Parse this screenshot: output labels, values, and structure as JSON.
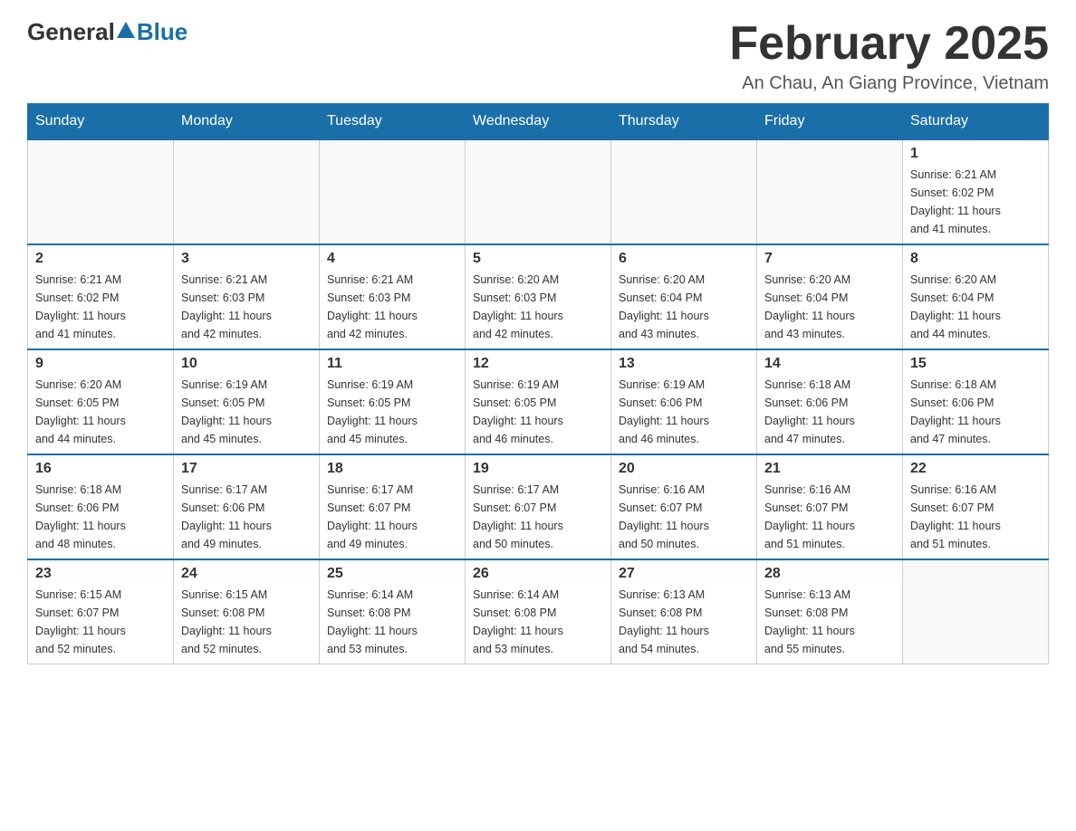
{
  "header": {
    "logo": {
      "general": "General",
      "blue": "Blue"
    },
    "title": "February 2025",
    "location": "An Chau, An Giang Province, Vietnam"
  },
  "days_of_week": [
    "Sunday",
    "Monday",
    "Tuesday",
    "Wednesday",
    "Thursday",
    "Friday",
    "Saturday"
  ],
  "weeks": [
    [
      {
        "day": "",
        "info": ""
      },
      {
        "day": "",
        "info": ""
      },
      {
        "day": "",
        "info": ""
      },
      {
        "day": "",
        "info": ""
      },
      {
        "day": "",
        "info": ""
      },
      {
        "day": "",
        "info": ""
      },
      {
        "day": "1",
        "info": "Sunrise: 6:21 AM\nSunset: 6:02 PM\nDaylight: 11 hours\nand 41 minutes."
      }
    ],
    [
      {
        "day": "2",
        "info": "Sunrise: 6:21 AM\nSunset: 6:02 PM\nDaylight: 11 hours\nand 41 minutes."
      },
      {
        "day": "3",
        "info": "Sunrise: 6:21 AM\nSunset: 6:03 PM\nDaylight: 11 hours\nand 42 minutes."
      },
      {
        "day": "4",
        "info": "Sunrise: 6:21 AM\nSunset: 6:03 PM\nDaylight: 11 hours\nand 42 minutes."
      },
      {
        "day": "5",
        "info": "Sunrise: 6:20 AM\nSunset: 6:03 PM\nDaylight: 11 hours\nand 42 minutes."
      },
      {
        "day": "6",
        "info": "Sunrise: 6:20 AM\nSunset: 6:04 PM\nDaylight: 11 hours\nand 43 minutes."
      },
      {
        "day": "7",
        "info": "Sunrise: 6:20 AM\nSunset: 6:04 PM\nDaylight: 11 hours\nand 43 minutes."
      },
      {
        "day": "8",
        "info": "Sunrise: 6:20 AM\nSunset: 6:04 PM\nDaylight: 11 hours\nand 44 minutes."
      }
    ],
    [
      {
        "day": "9",
        "info": "Sunrise: 6:20 AM\nSunset: 6:05 PM\nDaylight: 11 hours\nand 44 minutes."
      },
      {
        "day": "10",
        "info": "Sunrise: 6:19 AM\nSunset: 6:05 PM\nDaylight: 11 hours\nand 45 minutes."
      },
      {
        "day": "11",
        "info": "Sunrise: 6:19 AM\nSunset: 6:05 PM\nDaylight: 11 hours\nand 45 minutes."
      },
      {
        "day": "12",
        "info": "Sunrise: 6:19 AM\nSunset: 6:05 PM\nDaylight: 11 hours\nand 46 minutes."
      },
      {
        "day": "13",
        "info": "Sunrise: 6:19 AM\nSunset: 6:06 PM\nDaylight: 11 hours\nand 46 minutes."
      },
      {
        "day": "14",
        "info": "Sunrise: 6:18 AM\nSunset: 6:06 PM\nDaylight: 11 hours\nand 47 minutes."
      },
      {
        "day": "15",
        "info": "Sunrise: 6:18 AM\nSunset: 6:06 PM\nDaylight: 11 hours\nand 47 minutes."
      }
    ],
    [
      {
        "day": "16",
        "info": "Sunrise: 6:18 AM\nSunset: 6:06 PM\nDaylight: 11 hours\nand 48 minutes."
      },
      {
        "day": "17",
        "info": "Sunrise: 6:17 AM\nSunset: 6:06 PM\nDaylight: 11 hours\nand 49 minutes."
      },
      {
        "day": "18",
        "info": "Sunrise: 6:17 AM\nSunset: 6:07 PM\nDaylight: 11 hours\nand 49 minutes."
      },
      {
        "day": "19",
        "info": "Sunrise: 6:17 AM\nSunset: 6:07 PM\nDaylight: 11 hours\nand 50 minutes."
      },
      {
        "day": "20",
        "info": "Sunrise: 6:16 AM\nSunset: 6:07 PM\nDaylight: 11 hours\nand 50 minutes."
      },
      {
        "day": "21",
        "info": "Sunrise: 6:16 AM\nSunset: 6:07 PM\nDaylight: 11 hours\nand 51 minutes."
      },
      {
        "day": "22",
        "info": "Sunrise: 6:16 AM\nSunset: 6:07 PM\nDaylight: 11 hours\nand 51 minutes."
      }
    ],
    [
      {
        "day": "23",
        "info": "Sunrise: 6:15 AM\nSunset: 6:07 PM\nDaylight: 11 hours\nand 52 minutes."
      },
      {
        "day": "24",
        "info": "Sunrise: 6:15 AM\nSunset: 6:08 PM\nDaylight: 11 hours\nand 52 minutes."
      },
      {
        "day": "25",
        "info": "Sunrise: 6:14 AM\nSunset: 6:08 PM\nDaylight: 11 hours\nand 53 minutes."
      },
      {
        "day": "26",
        "info": "Sunrise: 6:14 AM\nSunset: 6:08 PM\nDaylight: 11 hours\nand 53 minutes."
      },
      {
        "day": "27",
        "info": "Sunrise: 6:13 AM\nSunset: 6:08 PM\nDaylight: 11 hours\nand 54 minutes."
      },
      {
        "day": "28",
        "info": "Sunrise: 6:13 AM\nSunset: 6:08 PM\nDaylight: 11 hours\nand 55 minutes."
      },
      {
        "day": "",
        "info": ""
      }
    ]
  ]
}
